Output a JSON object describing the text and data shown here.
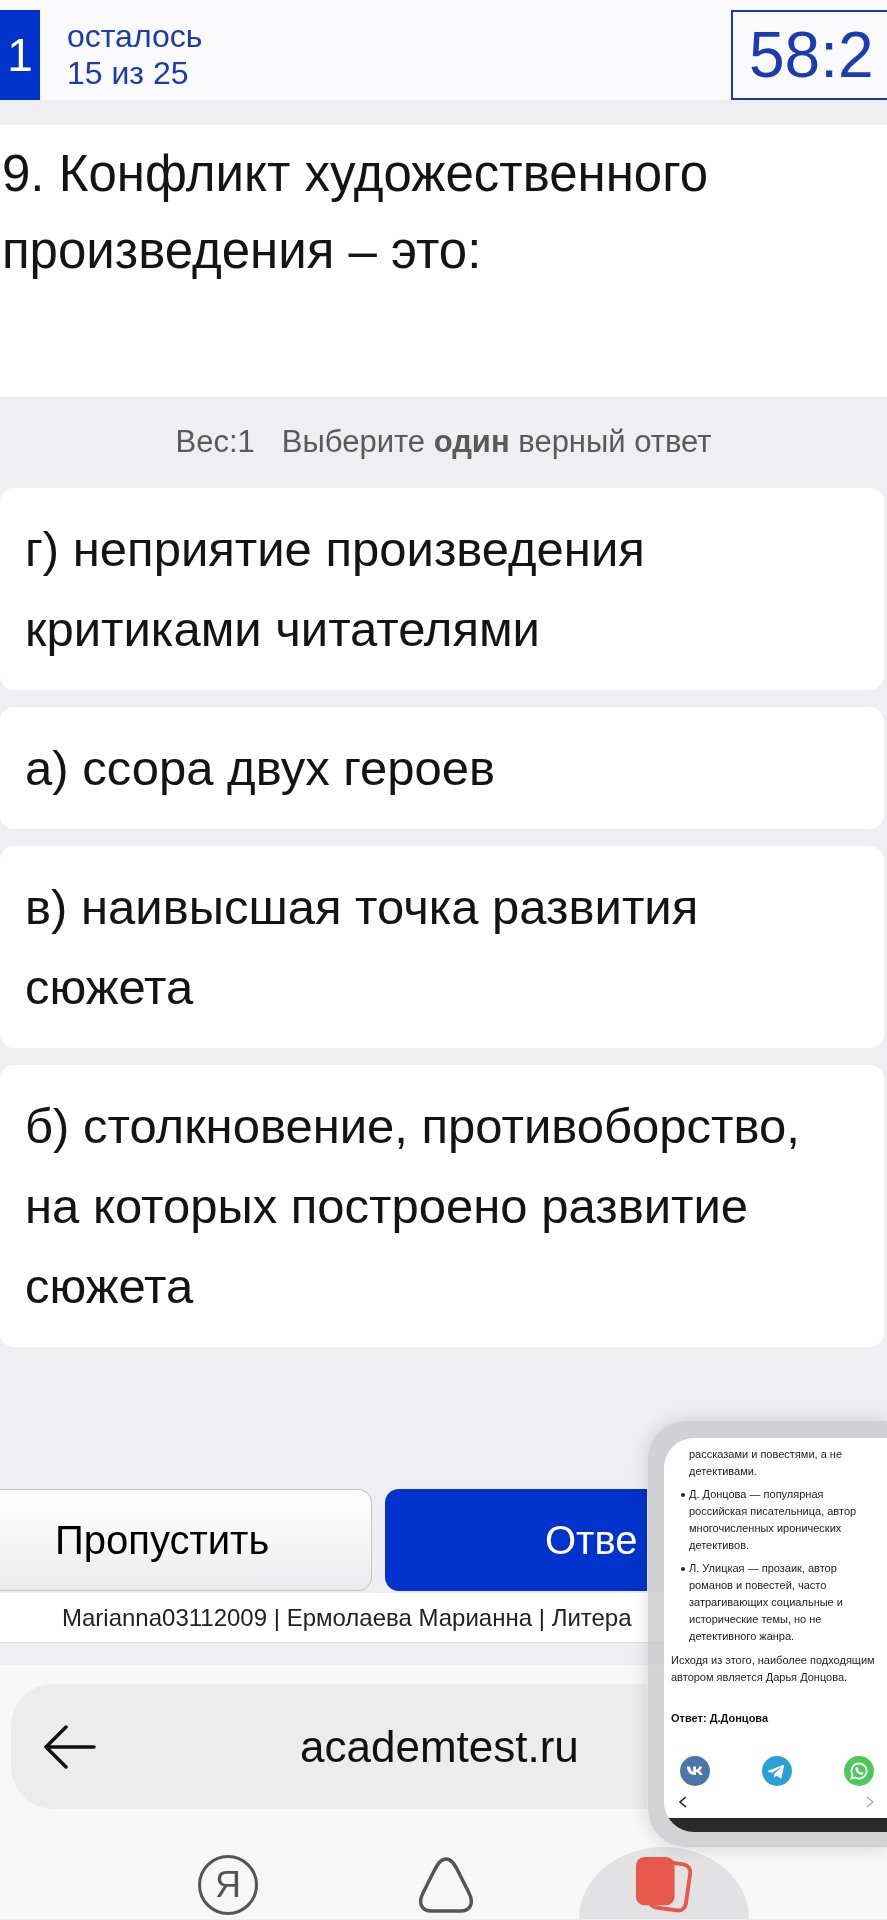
{
  "header": {
    "question_number": "1",
    "remaining_label": "осталось",
    "remaining_count": "15 из 25",
    "timer": "58:2"
  },
  "question": {
    "text": "9. Конфликт художественного произведения – это:"
  },
  "instructions": {
    "weight": "Вес:1",
    "hint": "Выберите **один** верный ответ"
  },
  "options": [
    {
      "text": "г) неприятие произведения критиками читателями",
      "selected": false
    },
    {
      "text": "а) ссора двух героев",
      "selected": false
    },
    {
      "text": "в) наивысшая точка развития сюжета",
      "selected": false
    },
    {
      "text": "б) столкновение, противоборство, на которых построено развитие сюжета",
      "selected": false
    }
  ],
  "actions": [
    {
      "kind": "secondary",
      "label": "Пропустить"
    },
    {
      "kind": "primary",
      "label": "Отве"
    }
  ],
  "footer": {
    "user_info": "Marianna03112009 | Ермолаева Марианна | Литера"
  },
  "browser": {
    "url": "academtest.ru",
    "nav": [
      {
        "kind": "yandex",
        "glyph": "Я",
        "selected": false
      },
      {
        "kind": "alice",
        "selected": false
      },
      {
        "kind": "tabs",
        "selected": true
      }
    ]
  },
  "preview": {
    "list": [
      {
        "kind": "continuation",
        "text": "рассказами и повестями, а не детективами."
      },
      {
        "kind": "bullet",
        "text": "Д. Донцова — популярная российская писательница, автор многочисленных иронических детективов."
      },
      {
        "kind": "bullet",
        "text": "Л. Улицкая — прозаик, автор романов и повестей, часто затрагивающих социальные и исторические темы, но не детективного жанра."
      }
    ],
    "conclusion": "Исходя из этого, наиболее подходящим автором является Дарья Донцова.",
    "answer": "Ответ: Д.Донцова",
    "share": [
      {
        "kind": "vk"
      },
      {
        "kind": "telegram"
      },
      {
        "kind": "whatsapp"
      }
    ]
  }
}
